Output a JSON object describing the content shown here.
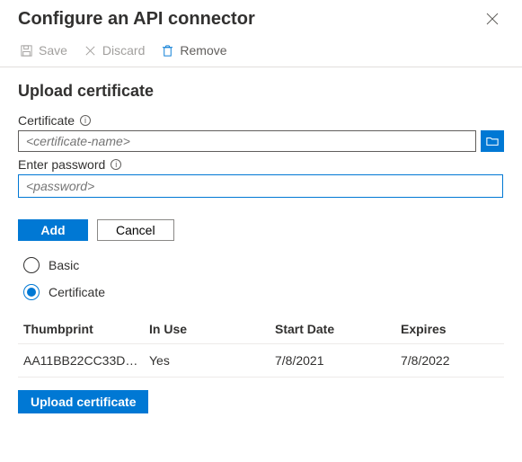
{
  "header": {
    "title": "Configure an API connector"
  },
  "toolbar": {
    "save": "Save",
    "discard": "Discard",
    "remove": "Remove"
  },
  "upload": {
    "section_title": "Upload certificate",
    "certificate_label": "Certificate",
    "certificate_placeholder": "<certificate-name>",
    "password_label": "Enter password",
    "password_placeholder": "<password>",
    "add_label": "Add",
    "cancel_label": "Cancel"
  },
  "auth_type": {
    "basic": "Basic",
    "certificate": "Certificate",
    "selected": "certificate"
  },
  "table": {
    "headers": {
      "thumbprint": "Thumbprint",
      "in_use": "In Use",
      "start_date": "Start Date",
      "expires": "Expires"
    },
    "rows": [
      {
        "thumbprint": "AA11BB22CC33DD4…",
        "in_use": "Yes",
        "start_date": "7/8/2021",
        "expires": "7/8/2022"
      }
    ]
  },
  "upload_button": "Upload certificate"
}
